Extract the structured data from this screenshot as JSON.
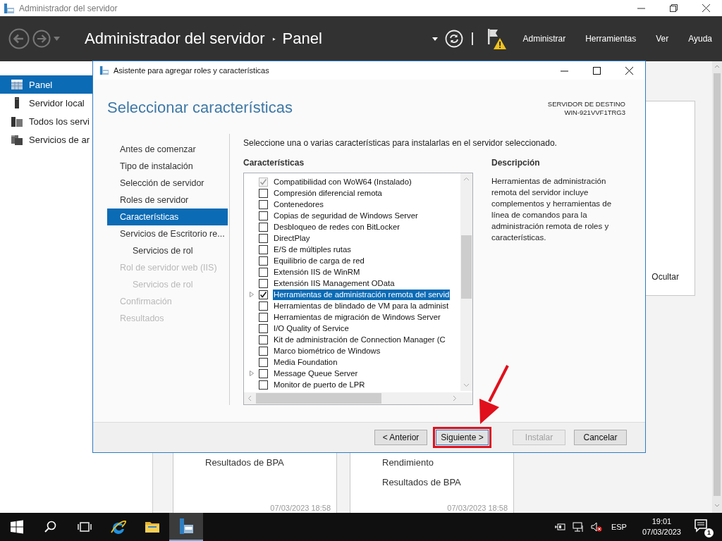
{
  "window": {
    "title": "Administrador del servidor"
  },
  "header": {
    "title": "Administrador del servidor",
    "separator": "‣",
    "breadcrumb": "Panel",
    "menu": [
      "Administrar",
      "Herramientas",
      "Ver",
      "Ayuda"
    ]
  },
  "sidebar": {
    "items": [
      {
        "label": "Panel",
        "selected": true,
        "kind": "dashboard"
      },
      {
        "label": "Servidor local",
        "selected": false,
        "kind": "server"
      },
      {
        "label": "Todos los servi",
        "selected": false,
        "kind": "servers"
      },
      {
        "label": "Servicios de ar",
        "selected": false,
        "kind": "files"
      }
    ]
  },
  "dashboard": {
    "hide_label": "Ocultar",
    "cards": [
      {
        "items": [
          "Resultados de BPA"
        ],
        "timestamp": "07/03/2023 18:58"
      },
      {
        "items": [
          "Rendimiento",
          "Resultados de BPA"
        ],
        "timestamp": "07/03/2023 18:58"
      }
    ]
  },
  "dialog": {
    "title": "Asistente para agregar roles y características",
    "heading": "Seleccionar características",
    "destination_label": "SERVIDOR DE DESTINO",
    "destination_server": "WIN-921VVF1TRG3",
    "steps": [
      {
        "label": "Antes de comenzar",
        "selected": false,
        "disabled": false
      },
      {
        "label": "Tipo de instalación",
        "selected": false,
        "disabled": false
      },
      {
        "label": "Selección de servidor",
        "selected": false,
        "disabled": false
      },
      {
        "label": "Roles de servidor",
        "selected": false,
        "disabled": false
      },
      {
        "label": "Características",
        "selected": true,
        "disabled": false
      },
      {
        "label": "Servicios de Escritorio re...",
        "selected": false,
        "disabled": false,
        "children": [
          {
            "label": "Servicios de rol",
            "selected": false,
            "disabled": false
          }
        ]
      },
      {
        "label": "Rol de servidor web (IIS)",
        "selected": false,
        "disabled": true,
        "children": [
          {
            "label": "Servicios de rol",
            "selected": false,
            "disabled": true
          }
        ]
      },
      {
        "label": "Confirmación",
        "selected": false,
        "disabled": true
      },
      {
        "label": "Resultados",
        "selected": false,
        "disabled": true
      }
    ],
    "intro": "Seleccione una o varias características para instalarlas en el servidor seleccionado.",
    "features_label": "Características",
    "features": [
      {
        "label": "Compatibilidad con WoW64 (Instalado)",
        "checked": true,
        "disabled": true,
        "expandable": false,
        "selected": false
      },
      {
        "label": "Compresión diferencial remota",
        "checked": false,
        "disabled": false,
        "expandable": false,
        "selected": false
      },
      {
        "label": "Contenedores",
        "checked": false,
        "disabled": false,
        "expandable": false,
        "selected": false
      },
      {
        "label": "Copias de seguridad de Windows Server",
        "checked": false,
        "disabled": false,
        "expandable": false,
        "selected": false
      },
      {
        "label": "Desbloqueo de redes con BitLocker",
        "checked": false,
        "disabled": false,
        "expandable": false,
        "selected": false
      },
      {
        "label": "DirectPlay",
        "checked": false,
        "disabled": false,
        "expandable": false,
        "selected": false
      },
      {
        "label": "E/S de múltiples rutas",
        "checked": false,
        "disabled": false,
        "expandable": false,
        "selected": false
      },
      {
        "label": "Equilibrio de carga de red",
        "checked": false,
        "disabled": false,
        "expandable": false,
        "selected": false
      },
      {
        "label": "Extensión IIS de WinRM",
        "checked": false,
        "disabled": false,
        "expandable": false,
        "selected": false
      },
      {
        "label": "Extensión IIS Management OData",
        "checked": false,
        "disabled": false,
        "expandable": false,
        "selected": false
      },
      {
        "label": "Herramientas de administración remota del servid",
        "checked": true,
        "disabled": false,
        "expandable": true,
        "selected": true
      },
      {
        "label": "Herramientas de blindado de VM para la administ",
        "checked": false,
        "disabled": false,
        "expandable": false,
        "selected": false
      },
      {
        "label": "Herramientas de migración de Windows Server",
        "checked": false,
        "disabled": false,
        "expandable": false,
        "selected": false
      },
      {
        "label": "I/O Quality of Service",
        "checked": false,
        "disabled": false,
        "expandable": false,
        "selected": false
      },
      {
        "label": "Kit de administración de Connection Manager (C",
        "checked": false,
        "disabled": false,
        "expandable": false,
        "selected": false
      },
      {
        "label": "Marco biométrico de Windows",
        "checked": false,
        "disabled": false,
        "expandable": false,
        "selected": false
      },
      {
        "label": "Media Foundation",
        "checked": false,
        "disabled": false,
        "expandable": false,
        "selected": false
      },
      {
        "label": "Message Queue Server",
        "checked": false,
        "disabled": false,
        "expandable": true,
        "selected": false
      },
      {
        "label": "Monitor de puerto de LPR",
        "checked": false,
        "disabled": false,
        "expandable": false,
        "selected": false
      }
    ],
    "description_label": "Descripción",
    "description": "Herramientas de administración remota del servidor incluye complementos y herramientas de línea de comandos para la administración remota de roles y características.",
    "buttons": [
      {
        "label": "< Anterior",
        "disabled": false,
        "highlighted": false
      },
      {
        "label": "Siguiente >",
        "disabled": false,
        "highlighted": true
      },
      {
        "label": "Instalar",
        "disabled": true,
        "highlighted": false
      },
      {
        "label": "Cancelar",
        "disabled": false,
        "highlighted": false
      }
    ]
  },
  "taskbar": {
    "apps": [
      {
        "kind": "ie",
        "active": false
      },
      {
        "kind": "folder",
        "active": false
      },
      {
        "kind": "server-manager",
        "active": true
      }
    ],
    "language": "ESP",
    "time": "19:01",
    "date": "07/03/2023",
    "notifications": "1"
  }
}
